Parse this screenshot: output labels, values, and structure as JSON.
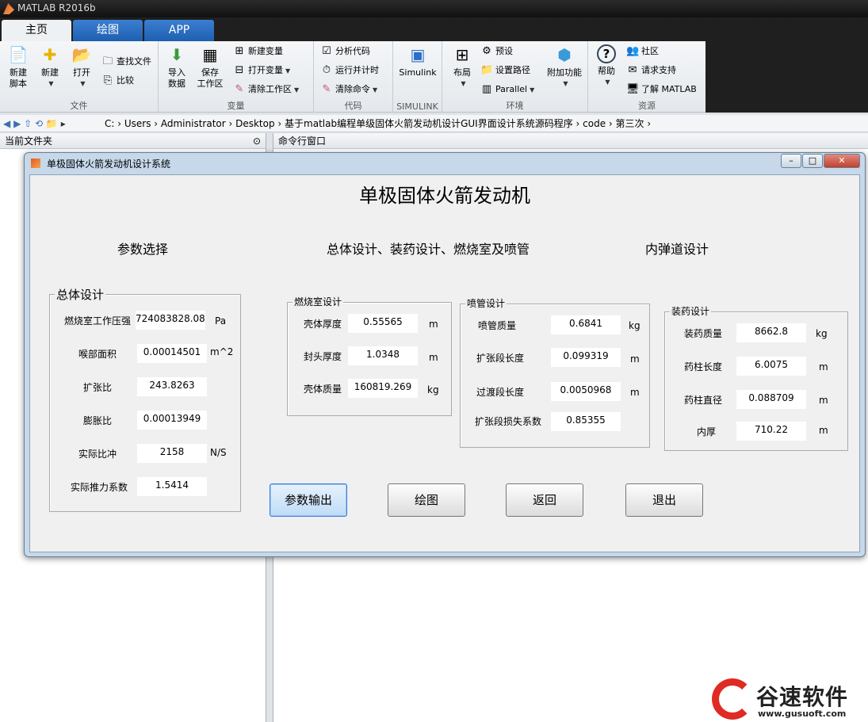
{
  "app": {
    "title": "MATLAB R2016b"
  },
  "tabs": [
    {
      "label": "主页"
    },
    {
      "label": "绘图"
    },
    {
      "label": "APP"
    }
  ],
  "ribbon": {
    "file": {
      "label": "文件",
      "new_script": "新建\n脚本",
      "new": "新建",
      "open": "打开",
      "find_files": "查找文件",
      "compare": "比较"
    },
    "variable": {
      "label": "变量",
      "import": "导入\n数据",
      "save_ws": "保存\n工作区",
      "new_var": "新建变量",
      "open_var": "打开变量",
      "clear_ws": "清除工作区"
    },
    "code": {
      "label": "代码",
      "analyze": "分析代码",
      "run_time": "运行并计时",
      "clear_cmd": "清除命令"
    },
    "simulink": {
      "label": "SIMULINK",
      "btn": "Simulink"
    },
    "env": {
      "label": "环境",
      "layout": "布局",
      "prefs": "预设",
      "set_path": "设置路径",
      "parallel": "Parallel",
      "addons": "附加功能"
    },
    "resources": {
      "label": "资源",
      "help": "帮助",
      "community": "社区",
      "support": "请求支持",
      "learn": "了解 MATLAB"
    }
  },
  "path": "C:  ›  Users  ›  Administrator  ›  Desktop  ›  基于matlab编程单级固体火箭发动机设计GUI界面设计系统源码程序  ›  code  ›  第三次  ›",
  "panels": {
    "current_folder": "当前文件夹",
    "command_window": "命令行窗口"
  },
  "gui": {
    "window_title": "单极固体火箭发动机设计系统",
    "heading": "单极固体火箭发动机",
    "section_params": "参数选择",
    "section_overall": "总体设计、装药设计、燃烧室及喷管",
    "section_ballistics": "内弹道设计",
    "overall": {
      "title": "总体设计",
      "rows": [
        {
          "label": "燃烧室工作压强",
          "value": "724083828.0844",
          "unit": "Pa"
        },
        {
          "label": "喉部面积",
          "value": "0.00014501",
          "unit": "m^2"
        },
        {
          "label": "扩张比",
          "value": "243.8263",
          "unit": ""
        },
        {
          "label": "膨胀比",
          "value": "0.00013949",
          "unit": ""
        },
        {
          "label": "实际比冲",
          "value": "2158",
          "unit": "N/S"
        },
        {
          "label": "实际推力系数",
          "value": "1.5414",
          "unit": ""
        }
      ]
    },
    "chamber": {
      "title": "燃烧室设计",
      "rows": [
        {
          "label": "壳体厚度",
          "value": "0.55565",
          "unit": "m"
        },
        {
          "label": "封头厚度",
          "value": "1.0348",
          "unit": "m"
        },
        {
          "label": "壳体质量",
          "value": "160819.269",
          "unit": "kg"
        }
      ]
    },
    "nozzle": {
      "title": "喷管设计",
      "rows": [
        {
          "label": "喷管质量",
          "value": "0.6841",
          "unit": "kg"
        },
        {
          "label": "扩张段长度",
          "value": "0.099319",
          "unit": "m"
        },
        {
          "label": "过渡段长度",
          "value": "0.0050968",
          "unit": "m"
        },
        {
          "label": "扩张段损失系数",
          "value": "0.85355",
          "unit": ""
        }
      ]
    },
    "charge": {
      "title": "装药设计",
      "rows": [
        {
          "label": "装药质量",
          "value": "8662.8",
          "unit": "kg"
        },
        {
          "label": "药柱长度",
          "value": "6.0075",
          "unit": "m"
        },
        {
          "label": "药柱直径",
          "value": "0.088709",
          "unit": "m"
        },
        {
          "label": "内厚",
          "value": "710.22",
          "unit": "m"
        }
      ]
    },
    "buttons": {
      "output": "参数输出",
      "plot": "绘图",
      "back": "返回",
      "exit": "退出"
    }
  },
  "brand": {
    "name": "谷速软件",
    "url": "www.gusuoft.com"
  }
}
